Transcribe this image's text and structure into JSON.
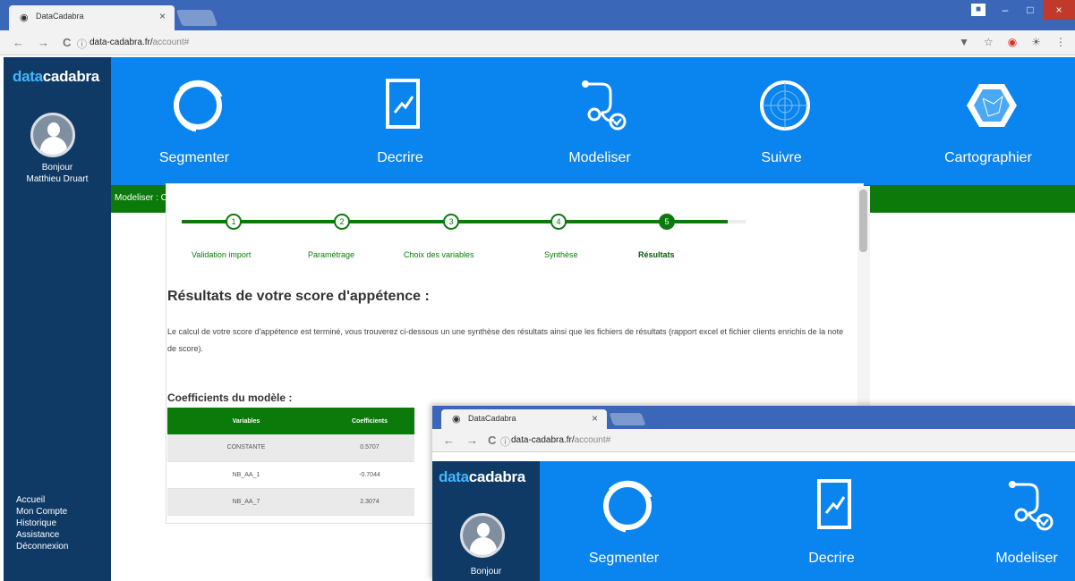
{
  "browser": {
    "tab_title": "DataCadabra",
    "tab_close": "×",
    "url_host": "data-cadabra.fr/",
    "url_path": "account#",
    "back_icon": "←",
    "forward_icon": "→",
    "reload_icon": "C",
    "info_icon": "ⓘ",
    "window_min": "–",
    "window_max": "□",
    "window_close": "×"
  },
  "logo": {
    "a": "data",
    "b": "cadabra"
  },
  "user": {
    "greeting": "Bonjour",
    "name": "Matthieu Druart"
  },
  "sidebar_menu": [
    "Accueil",
    "Mon Compte",
    "Historique",
    "Assistance",
    "Déconnexion"
  ],
  "topnav": [
    {
      "label": "Segmenter",
      "icon": "segment-ring-icon"
    },
    {
      "label": "Decrire",
      "icon": "chart-document-icon"
    },
    {
      "label": "Modeliser",
      "icon": "stethoscope-icon"
    },
    {
      "label": "Suivre",
      "icon": "radar-icon"
    },
    {
      "label": "Cartographier",
      "icon": "map-hexagon-icon"
    }
  ],
  "breadcrumb": "Modeliser : Construction d'un score d'appétence",
  "steps": [
    {
      "num": "1",
      "label": "Validation import"
    },
    {
      "num": "2",
      "label": "Paramétrage"
    },
    {
      "num": "3",
      "label": "Choix des variables"
    },
    {
      "num": "4",
      "label": "Synthèse"
    },
    {
      "num": "5",
      "label": "Résultats"
    }
  ],
  "active_step": 5,
  "results": {
    "title": "Résultats de votre score d'appétence :",
    "description": "Le calcul de votre score d'appétence est terminé, vous trouverez ci-dessous un une synthèse des résultats ainsi que les fichiers de résultats (rapport excel et fichier clients enrichis de la note de score).",
    "coef_title": "Coefficients du modèle :",
    "table": {
      "headers": [
        "Variables",
        "Coefficients"
      ],
      "rows": [
        [
          "CONSTANTE",
          "0.5707"
        ],
        [
          "NB_AA_1",
          "-0.7044"
        ],
        [
          "NB_AA_7",
          "2.3074"
        ]
      ]
    }
  },
  "colors": {
    "nav_blue": "#0a84ef",
    "sidebar_navy": "#0f3a66",
    "accent_green": "#0b7a0b",
    "chrome_blue": "#3b67b8"
  }
}
